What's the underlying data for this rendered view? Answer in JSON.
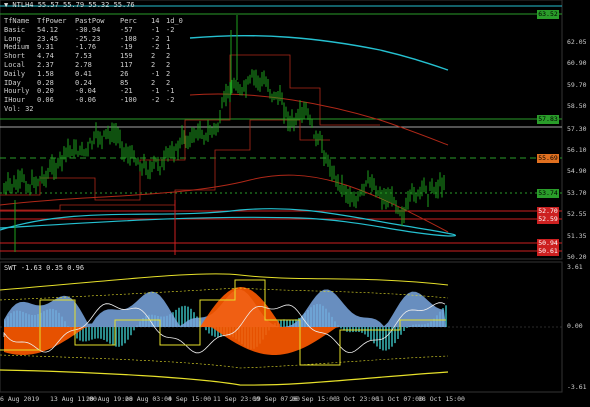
{
  "header": {
    "symbol_line": "▼ NTLH4  55.57 55.79 55.32 55.76"
  },
  "table": {
    "headers": [
      "TfName",
      "TfPower",
      "PastPow",
      "Perc",
      "14",
      "1d_0"
    ],
    "rows": [
      [
        "Basic",
        "54.12",
        "-30.94",
        "-57",
        "-1",
        "-2"
      ],
      [
        "Long",
        "23.45",
        "-25.23",
        "-108",
        "-2",
        "1"
      ],
      [
        "Medium",
        "9.31",
        "-1.76",
        "-19",
        "-2",
        "1"
      ],
      [
        "Short",
        "4.74",
        "7.53",
        "159",
        "2",
        "2"
      ],
      [
        "Local",
        "2.37",
        "2.78",
        "117",
        "2",
        "2"
      ],
      [
        "Daily",
        "1.58",
        "0.41",
        "26",
        "-1",
        "2"
      ],
      [
        "IDay",
        "0.28",
        "0.24",
        "85",
        "2",
        "2"
      ],
      [
        "Hourly",
        "0.20",
        "-0.04",
        "-21",
        "-1",
        "-1"
      ],
      [
        "IHour",
        "0.06",
        "-0.06",
        "-100",
        "-2",
        "-2"
      ]
    ],
    "footer": "Vol: 32"
  },
  "price_axis": {
    "labels": [
      "62.05",
      "60.90",
      "59.70",
      "58.50",
      "57.30",
      "56.10",
      "54.90",
      "53.70",
      "52.55",
      "51.35",
      "50.20"
    ],
    "tags": [
      {
        "text": "63.52",
        "bg": "#2a9d2a",
        "fg": "#000"
      },
      {
        "text": "57.83",
        "bg": "#2a9d2a",
        "fg": "#000"
      },
      {
        "text": "55.69",
        "bg": "#e07020",
        "fg": "#000"
      },
      {
        "text": "53.74",
        "bg": "#2a9d2a",
        "fg": "#000"
      },
      {
        "text": "52.70",
        "bg": "#cc2020",
        "fg": "#fff"
      },
      {
        "text": "52.59",
        "bg": "#cc2020",
        "fg": "#fff"
      },
      {
        "text": "50.94",
        "bg": "#cc2020",
        "fg": "#fff"
      },
      {
        "text": "50.61",
        "bg": "#cc2020",
        "fg": "#fff"
      }
    ]
  },
  "indicator": {
    "header": "SWT -1.63 0.35 0.96",
    "axis_labels": [
      "3.61",
      "0.00",
      "-3.61"
    ]
  },
  "time_axis": {
    "labels": [
      "6 Aug 2019",
      "13 Aug 11:00",
      "20 Aug 19:00",
      "28 Aug 03:00",
      "4 Sep 15:00",
      "11 Sep 23:00",
      "19 Sep 07:00",
      "26 Sep 15:00",
      "3 Oct 23:00",
      "11 Oct 07:00",
      "18 Oct 15:00"
    ]
  },
  "colors": {
    "candle": "#1ea01e",
    "ma_cyan": "#25c0d0",
    "ma_red": "#b02818",
    "level_green": "#2a9d2a",
    "level_red": "#cc2020",
    "orange": "#ff5a00",
    "blue_hist": "#7aa7e0",
    "teal_hist": "#2a8a8a",
    "yellow": "#e6e02a"
  }
}
